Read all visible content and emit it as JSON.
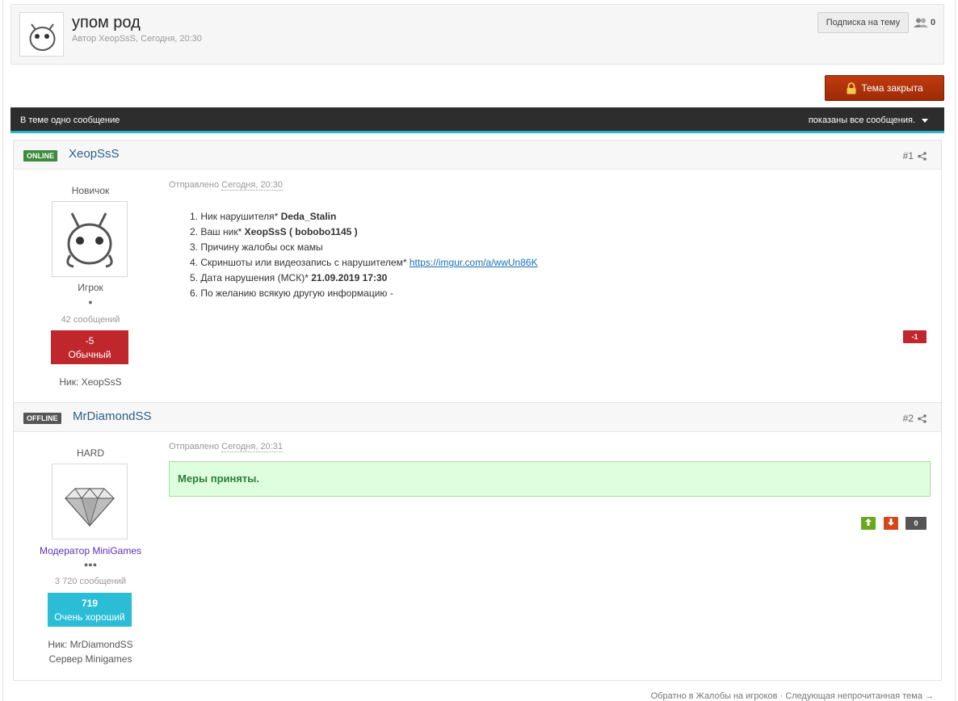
{
  "topic": {
    "title": "упом род",
    "meta": "Автор XeopSsS, Сегодня, 20:30",
    "follow_label": "Подписка на тему",
    "followers_count": "0"
  },
  "closed_label": "Тема закрыта",
  "bar": {
    "left_text": "В теме одно сообщение",
    "right_text": "показаны все сообщения."
  },
  "posts": [
    {
      "status": "ONLINE",
      "author": "XeopSsS",
      "num": "#1",
      "group_title": "Новичок",
      "rank": "Игрок",
      "pips": "●",
      "post_count": "42 сообщений",
      "rep_value": "-5",
      "rep_label": "Обычный",
      "nick": "Ник: XeopSsS",
      "posted_label": "Отправлено",
      "posted_time": "Сегодня, 20:30",
      "lines": [
        {
          "n": "1.",
          "text": "Ник нарушителя* ",
          "bold": "Deda_Stalin"
        },
        {
          "n": "2.",
          "text": "Ваш ник* ",
          "bold": "XeopSsS ( bobobo1145 )"
        },
        {
          "n": "3.",
          "text": "Причину жалобы оск мамы",
          "bold": ""
        },
        {
          "n": "4.",
          "text": "Скриншоты или видеозапись с нарушителем* ",
          "link": "https://imgur.com/a/wwUn86K"
        },
        {
          "n": "5.",
          "text": "Дата нарушения (МСК)* ",
          "bold": "21.09.2019 17:30"
        },
        {
          "n": "6.",
          "text": "По желанию всякую другую информацию -",
          "bold": ""
        }
      ],
      "post_rep": "-1"
    },
    {
      "status": "OFFLINE",
      "author": "MrDiamondSS",
      "num": "#2",
      "group_title": "HARD",
      "rank": "Модератор MiniGames",
      "pips": "●●●",
      "post_count": "3 720 сообщений",
      "rep_value": "719",
      "rep_label": "Очень хороший",
      "nick": "Ник: MrDiamondSS",
      "server": "Сервер Minigames",
      "posted_label": "Отправлено",
      "posted_time": "Сегодня, 20:31",
      "notice": "Меры приняты.",
      "post_rep": "0"
    }
  ],
  "footer": {
    "back_link": "Обратно в Жалобы на игроков",
    "sep": " · ",
    "next_link": "Следующая непрочитанная тема →"
  },
  "colors": {
    "accent": "#2bb4cd",
    "closed": "#a82f08",
    "rep_bad": "#c0272d",
    "rep_good": "#2bbcd6",
    "online": "#3d8a3d"
  }
}
